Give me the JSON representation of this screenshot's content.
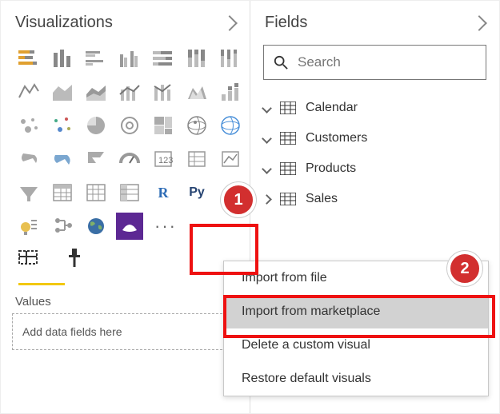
{
  "viz_panel": {
    "title": "Visualizations",
    "values_label": "Values",
    "drop_hint": "Add data fields here"
  },
  "fields_panel": {
    "title": "Fields",
    "search_placeholder": "Search",
    "tables": [
      {
        "name": "Calendar"
      },
      {
        "name": "Customers"
      },
      {
        "name": "Products"
      },
      {
        "name": "Sales"
      }
    ]
  },
  "context_menu": {
    "items": [
      {
        "label": "Import from file"
      },
      {
        "label": "Import from marketplace",
        "hover": true
      },
      {
        "label": "Delete a custom visual"
      },
      {
        "label": "Restore default visuals"
      }
    ]
  },
  "viz_icons_row1": [
    "stacked-bar",
    "stacked-column",
    "clustered-bar",
    "clustered-column",
    "hundred-bar",
    "hundred-column",
    "line"
  ],
  "viz_icons_row2": [
    "area",
    "stacked-area",
    "line-stacked",
    "line-clustered",
    "ribbon",
    "waterfall",
    "scatter"
  ],
  "viz_icons_row3": [
    "pie",
    "donut",
    "treemap",
    "map",
    "filled-map",
    "funnel",
    "gauge"
  ],
  "viz_icons_row4": [
    "card",
    "multi-row-card",
    "kpi",
    "slicer",
    "table",
    "matrix",
    "r-script"
  ],
  "viz_icons_row5": [
    "python",
    "key-influencers",
    "decomposition",
    "qa",
    "text",
    "r-visual",
    "py-visual"
  ],
  "viz_icons_row6": [
    "bulb1",
    "bulb2",
    "globe-viz",
    "arcgis",
    "more"
  ],
  "callouts": {
    "one": "1",
    "two": "2"
  },
  "colors": {
    "accent": "#F2C811",
    "callout": "#D22F2F",
    "highlight_border": "#E11",
    "purple": "#5C2893"
  }
}
